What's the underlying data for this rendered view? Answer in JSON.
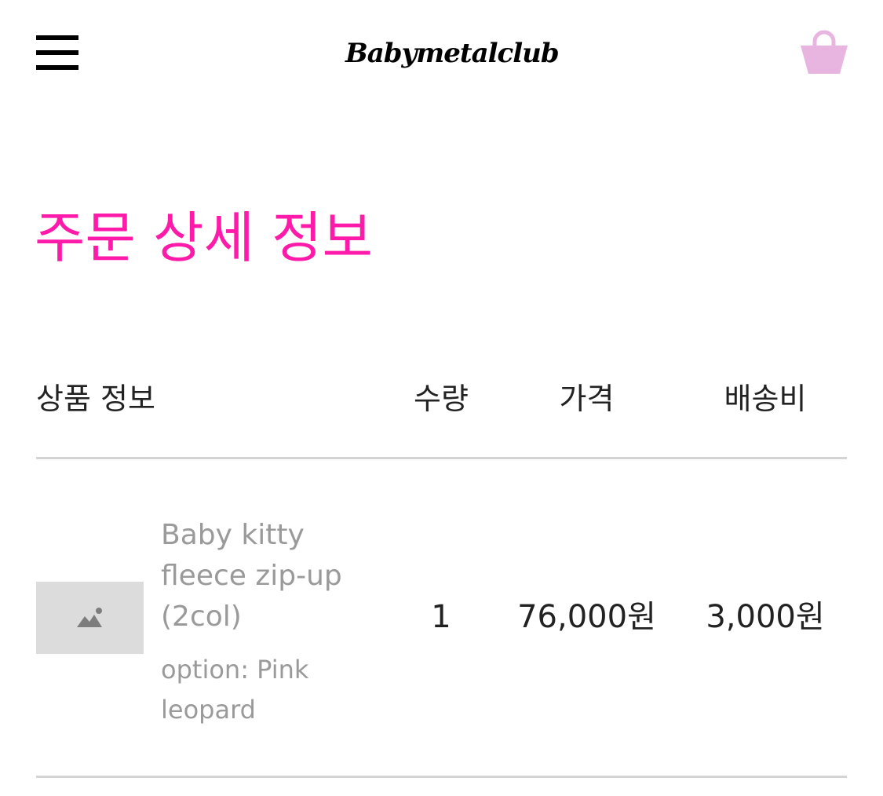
{
  "header": {
    "logo_text": "Babymetalclub",
    "menu_icon": "hamburger-menu-icon",
    "cart_icon": "shopping-basket-icon",
    "cart_color": "#e8b4e0"
  },
  "page": {
    "title": "주문 상세 정보",
    "title_color": "#ff1aaa"
  },
  "table": {
    "headers": {
      "product": "상품 정보",
      "quantity": "수량",
      "price": "가격",
      "shipping": "배송비"
    },
    "rows": [
      {
        "thumbnail_icon": "image-placeholder-icon",
        "product_name": "Baby kitty fleece zip-up (2col)",
        "option": "option: Pink leopard",
        "quantity": "1",
        "price": "76,000원",
        "shipping": "3,000원"
      }
    ]
  }
}
